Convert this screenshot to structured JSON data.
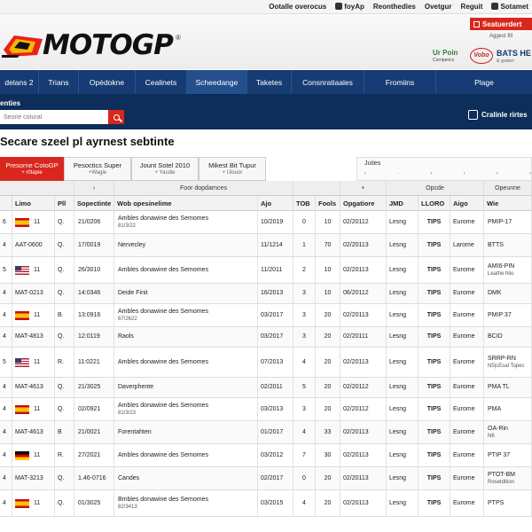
{
  "topbar": {
    "links": [
      "Ootalle overocus",
      "foyAp",
      "Reonthedies",
      "Ovetgur",
      "Reguit",
      "Sotamet"
    ]
  },
  "header": {
    "logo_text": "MOTOGP",
    "logo_mark": "®",
    "tickets_button": "Seatuerdert",
    "sub_text": "Aggest fill",
    "sponsors": [
      {
        "name": "Ur Poin",
        "sub": "Corriperics"
      },
      {
        "name": "Vobo",
        "sub": ""
      },
      {
        "name": "BATS HE",
        "sub": "& ypaten"
      }
    ]
  },
  "nav": {
    "items": [
      {
        "label": "delans 2",
        "active": false
      },
      {
        "label": "Trians",
        "active": false
      },
      {
        "label": "Opédokne",
        "active": false
      },
      {
        "label": "Cealinets",
        "active": false
      },
      {
        "label": "Scheedange",
        "active": true
      },
      {
        "label": "Taketes",
        "active": false
      },
      {
        "label": "Consnratiaales",
        "active": false
      },
      {
        "label": "Fromiins",
        "active": false
      },
      {
        "label": "Plage",
        "active": false
      }
    ]
  },
  "search": {
    "label": "enties",
    "placeholder": "Seone cotural",
    "calendar_link": "Cralinle rirtes"
  },
  "page": {
    "title": "Secare szeel pl ayrnest sebtinte"
  },
  "tabs": [
    {
      "label": "Presorne CotoGP",
      "sub": "+ r0tapie",
      "active": true
    },
    {
      "label": "Pesoctics Super",
      "sub": "+Wagie",
      "active": false
    },
    {
      "label": "Jount Sotel 2010",
      "sub": "+ Yacdie",
      "active": false
    },
    {
      "label": "Mikest Bit Tupur",
      "sub": "+ Ulouor",
      "active": false
    }
  ],
  "filter": {
    "label": "Juties",
    "marks": [
      "‹",
      "·",
      "›",
      "›",
      "›",
      "›"
    ]
  },
  "table": {
    "group_header": [
      "",
      "›",
      "Foor dopdarnces",
      "",
      "+",
      "Opcde",
      "Opeunne"
    ],
    "columns": [
      "",
      "Limo",
      "Pll",
      "Sopectinte",
      "Wob opesinelime",
      "Ajo",
      "TOB",
      "Fools",
      "Opgatiore",
      "JMD",
      "LLORO",
      "Aigo",
      "Wie"
    ],
    "rows": [
      {
        "idx": "6",
        "flag": "es",
        "num": "11",
        "pll": "Q.",
        "date": "21/0206",
        "title": "Ambles donawine des Semomes",
        "title_sub": "81/3/22",
        "ajo": "10/2019",
        "tob": "0",
        "fools": "10",
        "opg": "02/20112",
        "jmd": "Lesng",
        "lloro": "TIPS",
        "aigo": "Eurome",
        "wie": "PMIP-17",
        "wie_sub": ""
      },
      {
        "idx": "4",
        "flag": "",
        "num": "AAT-0600",
        "pll": "Q.",
        "date": "17/0019",
        "title": "Nervecley",
        "title_sub": "",
        "ajo": "11/1214",
        "tob": "1",
        "fools": "70",
        "opg": "02/20113",
        "jmd": "Lesng",
        "lloro": "TIPS",
        "aigo": "Larome",
        "wie": "BTTS",
        "wie_sub": ""
      },
      {
        "idx": "5",
        "flag": "us",
        "num": "11",
        "pll": "Q.",
        "date": "26/3010",
        "title": "Ambles donawine des Semomes",
        "title_sub": "",
        "ajo": "11/2011",
        "tob": "2",
        "fools": "10",
        "opg": "02/20113",
        "jmd": "Lesng",
        "lloro": "TIPS",
        "aigo": "Eurome",
        "wie": "AMI6-PIN",
        "wie_sub": "Leathe hlio"
      },
      {
        "idx": "4",
        "flag": "",
        "num": "MAT-0213",
        "pll": "Q.",
        "date": "14:0346",
        "title": "Deide Finit",
        "title_sub": "",
        "ajo": "16/2013",
        "tob": "3",
        "fools": "10",
        "opg": "06/20112",
        "jmd": "Lesng",
        "lloro": "TIPS",
        "aigo": "Eurome",
        "wie": "DMK",
        "wie_sub": ""
      },
      {
        "idx": "4",
        "flag": "es",
        "num": "11",
        "pll": "B.",
        "date": "13:0916",
        "title": "Ambles donawine des Semomes",
        "title_sub": "67/2622",
        "ajo": "03/2017",
        "tob": "3",
        "fools": "20",
        "opg": "02/20113",
        "jmd": "Lesng",
        "lloro": "TIPS",
        "aigo": "Eurome",
        "wie": "PMIP 37",
        "wie_sub": ""
      },
      {
        "idx": "4",
        "flag": "",
        "num": "MAT-4813",
        "pll": "Q.",
        "date": "12:0119",
        "title": "Raols",
        "title_sub": "",
        "ajo": "03/2017",
        "tob": "3",
        "fools": "20",
        "opg": "02/20111",
        "jmd": "Lesng",
        "lloro": "TIPS",
        "aigo": "Eurome",
        "wie": "BCID",
        "wie_sub": ""
      },
      {
        "idx": "5",
        "flag": "us",
        "num": "11",
        "pll": "R.",
        "date": "11:0221",
        "title": "Ambles donawine des Semomes",
        "title_sub": "",
        "ajo": "07/2013",
        "tob": "4",
        "fools": "20",
        "opg": "02/20113",
        "jmd": "Lesng",
        "lloro": "TIPS",
        "aigo": "Eurome",
        "wie": "SRRP-RN",
        "wie_sub": "N5|cEsal Topec"
      },
      {
        "idx": "4",
        "flag": "",
        "num": "MAT-4613",
        "pll": "Q.",
        "date": "21/3025",
        "title": "Daverphente",
        "title_sub": "",
        "ajo": "02/2011",
        "tob": "5",
        "fools": "20",
        "opg": "02/20112",
        "jmd": "Lesng",
        "lloro": "TIPS",
        "aigo": "Eurome",
        "wie": "PMA TL",
        "wie_sub": ""
      },
      {
        "idx": "4",
        "flag": "es",
        "num": "11",
        "pll": "Q.",
        "date": "02/0921",
        "title": "Ambles donawine des Semomes",
        "title_sub": "81/3/23",
        "ajo": "03/2013",
        "tob": "3",
        "fools": "20",
        "opg": "02/20112",
        "jmd": "Lesng",
        "lloro": "TIPS",
        "aigo": "Eurome",
        "wie": "PMA",
        "wie_sub": ""
      },
      {
        "idx": "4",
        "flag": "",
        "num": "MAT-4613",
        "pll": "B",
        "date": "21/0021",
        "title": "Forentahten",
        "title_sub": "",
        "ajo": "01/2017",
        "tob": "4",
        "fools": "33",
        "opg": "02/20113",
        "jmd": "Lesng",
        "lloro": "TIPS",
        "aigo": "Eurome",
        "wie": "OA-Rin",
        "wie_sub": "N6"
      },
      {
        "idx": "4",
        "flag": "de",
        "num": "11",
        "pll": "R.",
        "date": "27/2021",
        "title": "Ambles donawine des Semomes",
        "title_sub": "",
        "ajo": "03/2012",
        "tob": "7",
        "fools": "30",
        "opg": "02/20113",
        "jmd": "Lesng",
        "lloro": "TIPS",
        "aigo": "Eurome",
        "wie": "PTIP 37",
        "wie_sub": ""
      },
      {
        "idx": "4",
        "flag": "",
        "num": "MAT-3213",
        "pll": "Q.",
        "date": "1.46-0716",
        "title": "Candes",
        "title_sub": "",
        "ajo": "02/2017",
        "tob": "0",
        "fools": "20",
        "opg": "02/20113",
        "jmd": "Lesng",
        "lloro": "TIPS",
        "aigo": "Eurome",
        "wie": "PTOT-BM",
        "wie_sub": "Rosetdltion"
      },
      {
        "idx": "4",
        "flag": "es",
        "num": "11",
        "pll": "Q.",
        "date": "01/3025",
        "title": "Bmbles donawine des Semomes",
        "title_sub": "82/3413",
        "ajo": "03/2015",
        "tob": "4",
        "fools": "20",
        "opg": "02/20113",
        "jmd": "Lesng",
        "lloro": "TIPS",
        "aigo": "Eurome",
        "wie": "PTPS",
        "wie_sub": ""
      }
    ]
  },
  "colors": {
    "nav_bg": "#163c73",
    "search_bg": "#0d2d5b",
    "accent_red": "#d8271c"
  }
}
